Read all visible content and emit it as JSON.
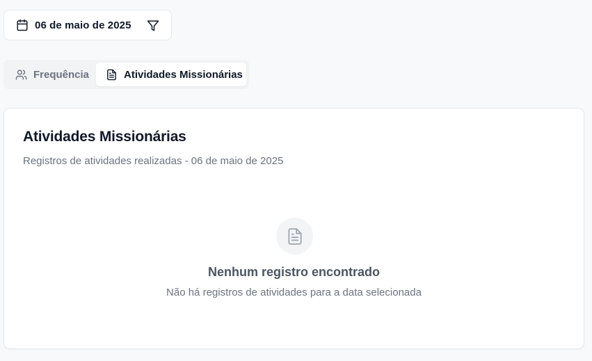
{
  "date_filter": {
    "date_label": "06 de maio de 2025",
    "date_icon": "calendar-icon",
    "filter_icon": "filter-icon"
  },
  "tabs": [
    {
      "label": "Frequência",
      "icon": "users-icon",
      "active": false
    },
    {
      "label": "Atividades Missionárias",
      "icon": "file-text-icon",
      "active": true
    }
  ],
  "card": {
    "title": "Atividades Missionárias",
    "subtitle": "Registros de atividades realizadas - 06 de maio de 2025",
    "empty_state": {
      "icon": "file-text-icon",
      "title": "Nenhum registro encontrado",
      "text": "Não há registros de atividades para a data selecionada"
    }
  },
  "colors": {
    "background": "#f8f9fa",
    "text_primary": "#111827",
    "text_muted": "#6b7280"
  }
}
